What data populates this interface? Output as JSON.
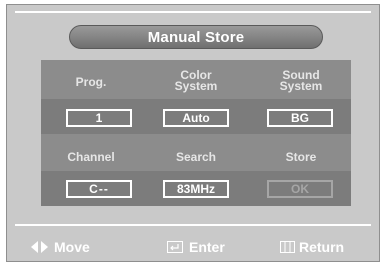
{
  "title": "Manual Store",
  "row1": {
    "labels": {
      "prog": "Prog.",
      "color_system_line1": "Color",
      "color_system_line2": "System",
      "sound_system_line1": "Sound",
      "sound_system_line2": "System"
    },
    "values": {
      "prog": "1",
      "color_system": "Auto",
      "sound_system": "BG"
    }
  },
  "row2": {
    "labels": {
      "channel": "Channel",
      "search": "Search",
      "store": "Store"
    },
    "values": {
      "channel": "C--",
      "search": "83MHz",
      "store": "OK"
    }
  },
  "nav": {
    "move": "Move",
    "enter": "Enter",
    "return": "Return"
  },
  "colors": {
    "background": "#c9c9c9",
    "panel": "#8c8c8c",
    "band": "#7c7c7c",
    "text": "#ffffff"
  },
  "icons": {
    "move": "left-right-arrows-icon",
    "enter": "enter-icon",
    "return": "return-icon"
  }
}
